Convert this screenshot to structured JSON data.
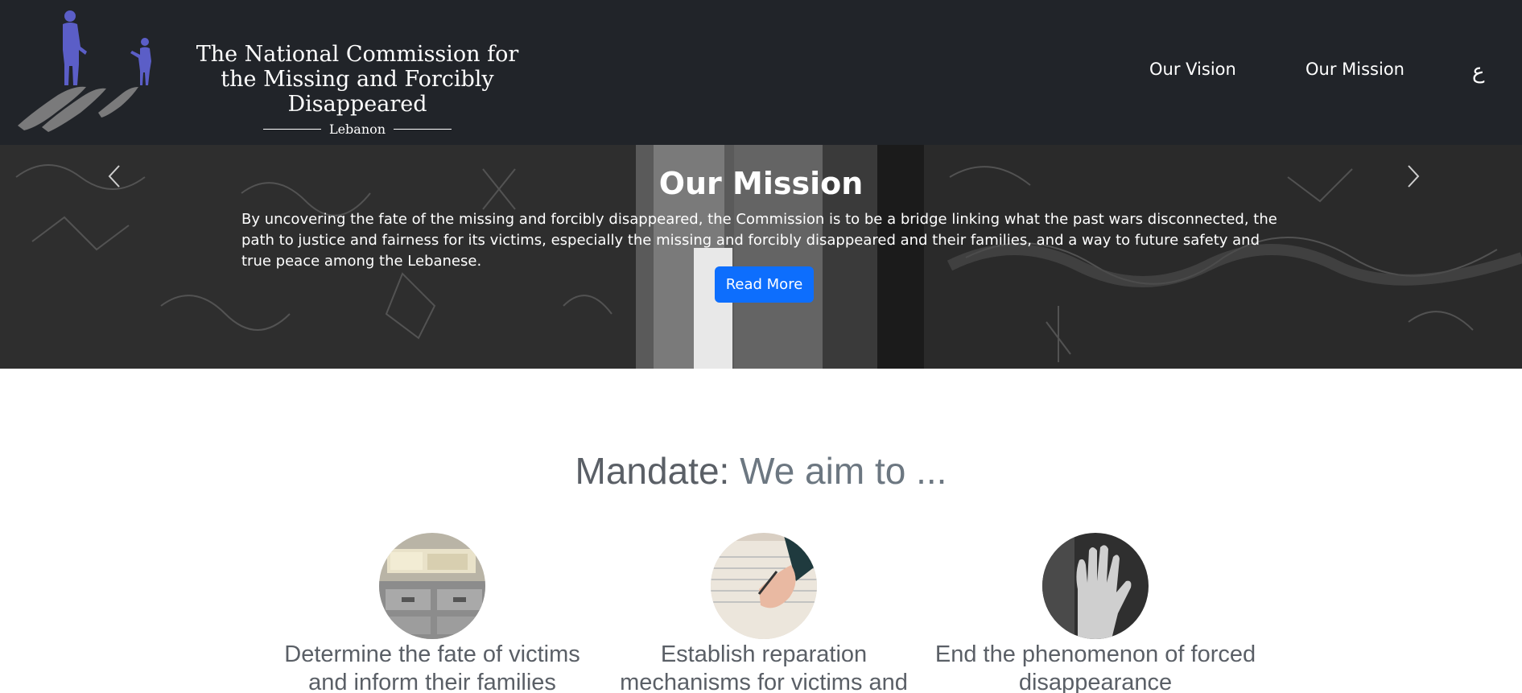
{
  "header": {
    "brand": {
      "line1": "The National Commission for",
      "line2": "the Missing and Forcibly Disappeared",
      "sub": "Lebanon"
    },
    "nav": {
      "vision": "Our Vision",
      "mission": "Our Mission",
      "lang": "ع"
    }
  },
  "hero": {
    "title": "Our Mission",
    "text": "By uncovering the fate of the missing and forcibly disappeared, the Commission is to be a bridge linking what the past wars disconnected, the path to justice and fairness for its victims, especially the missing and forcibly disappeared and their families, and a way to future safety and true peace among the Lebanese.",
    "button": "Read More"
  },
  "mandate": {
    "title_part1": "Mandate:",
    "title_part2": "We aim to ...",
    "cards": [
      {
        "caption": "Determine the fate of victims and inform their families",
        "image": "filing-cabinet-photo"
      },
      {
        "caption": "Establish reparation mechanisms for victims and",
        "image": "writing-notebook-photo"
      },
      {
        "caption": "End the phenomenon of forced disappearance",
        "image": "raised-hand-photo"
      }
    ]
  },
  "colors": {
    "header_bg": "#212429",
    "logo_purple": "#5b5ec7",
    "button_blue": "#0d6efd",
    "heading_gray": "#5a5f66"
  }
}
